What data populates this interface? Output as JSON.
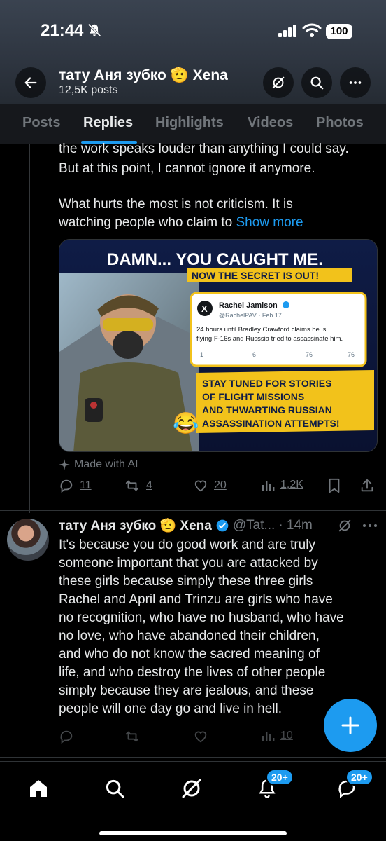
{
  "status_bar": {
    "time": "21:44",
    "battery": "100"
  },
  "header": {
    "profile_name": "тату Аня зубко 🫡 Xena",
    "post_count": "12,5K posts",
    "icons": {
      "back": "back-arrow-icon",
      "grok": "grok-icon",
      "search": "search-icon",
      "more": "more-icon"
    }
  },
  "tabs": [
    {
      "label": "Posts"
    },
    {
      "label": "Replies"
    },
    {
      "label": "Highlights"
    },
    {
      "label": "Videos"
    },
    {
      "label": "Photos"
    }
  ],
  "active_tab": "Replies",
  "post1": {
    "lines": [
      "the work speaks louder than anything I could say.",
      "But at this point, I cannot ignore it anymore.",
      "What hurts the most is not criticism. It is",
      "watching people who claim to"
    ],
    "show_more": "Show more",
    "media": {
      "headline": "DAMN... YOU CAUGHT ME.",
      "subheadline": "NOW THE SECRET IS OUT!",
      "tweet_name": "Rachel Jamison",
      "tweet_handle": "@RachelPAV · Feb 17",
      "tweet_text_1": "24 hours until Bradley Crawford claims he is",
      "tweet_text_2": "flying F-16s and Russsia tried to assassinate him.",
      "tweet_replies": "1",
      "tweet_reposts": "6",
      "tweet_likes": "76",
      "tweet_views": "76",
      "banner_1": "STAY TUNED FOR STORIES",
      "banner_2": "OF FLIGHT MISSIONS",
      "banner_3": "AND THWARTING RUSSIAN",
      "banner_4": "ASSASSINATION ATTEMPTS!",
      "emoji": "😂"
    },
    "made_with_ai": "Made with AI",
    "replies": "11",
    "reposts": "4",
    "likes": "20",
    "views": "1,2K"
  },
  "post2": {
    "name": "тату Аня зубко 🫡 Xena",
    "handle": "@Tat...",
    "time": "· 14m",
    "lines": [
      "It's because you do good work and are truly",
      "someone important that you are attacked by",
      "these girls because simply these three girls",
      "Rachel and April and Trinzu are girls who have",
      "no recognition, who have no husband, who have",
      "no love, who have abandoned their children,",
      "and who do not know the sacred meaning of",
      "life, and who destroy the lives of other people",
      "simply because they are jealous, and these",
      "people will one day go and live in hell."
    ],
    "views": "10"
  },
  "bottom_nav": {
    "notifications_badge": "20+",
    "messages_badge": "20+"
  },
  "colors": {
    "accent": "#1d9bf0",
    "muted": "#71767b",
    "text": "#e7e9ea",
    "background": "#000000"
  }
}
